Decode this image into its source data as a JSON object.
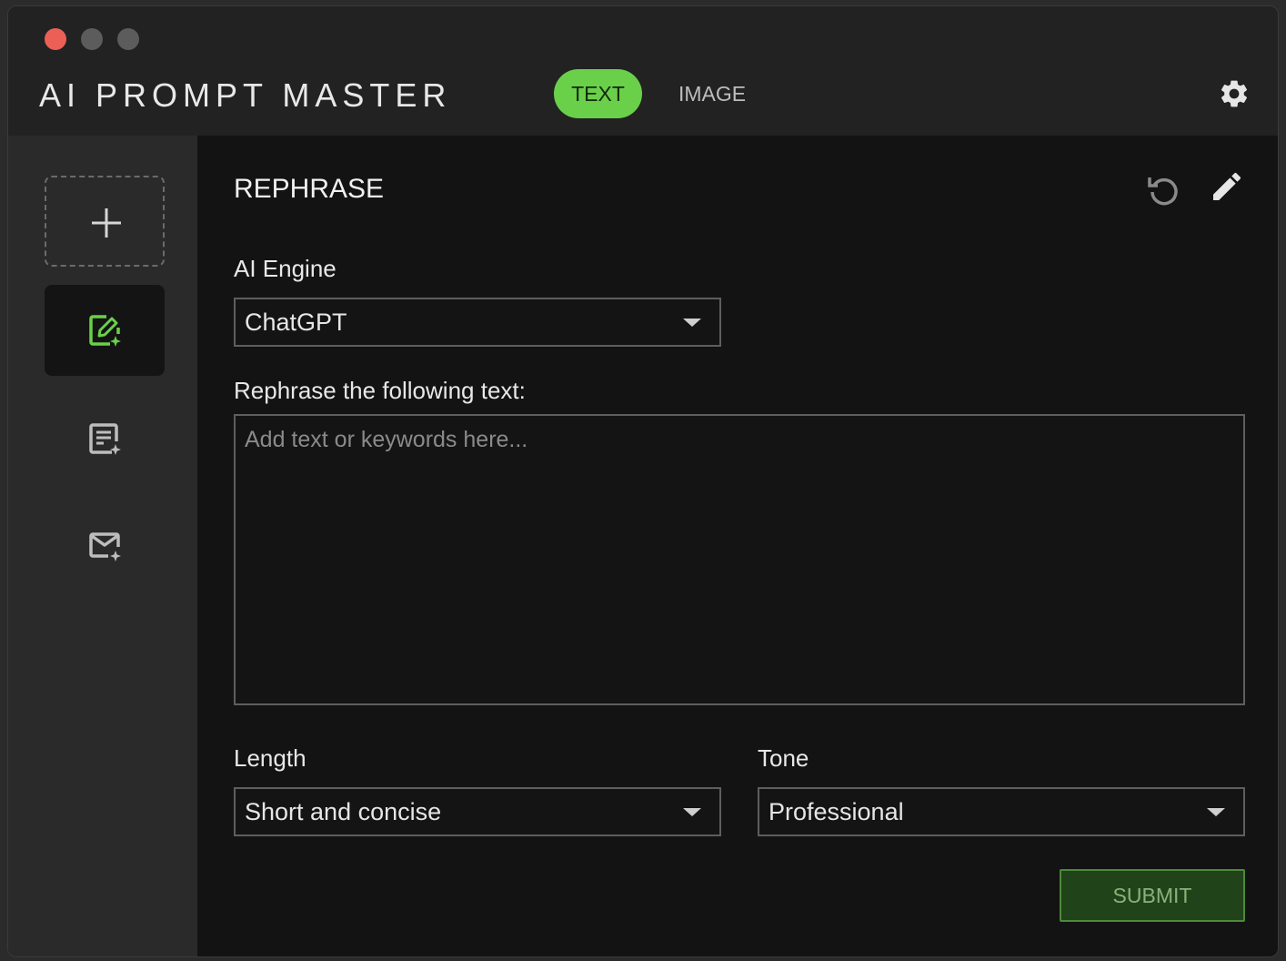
{
  "window": {
    "traffic_lights": [
      "close",
      "minimize",
      "maximize"
    ]
  },
  "header": {
    "app_title": "AI PROMPT MASTER",
    "tabs": [
      {
        "label": "TEXT",
        "active": true
      },
      {
        "label": "IMAGE",
        "active": false
      }
    ],
    "settings_icon": "gear-icon"
  },
  "sidebar": {
    "add_icon": "plus-icon",
    "items": [
      {
        "icon": "edit-sparkle-icon",
        "active": true
      },
      {
        "icon": "document-sparkle-icon",
        "active": false
      },
      {
        "icon": "mail-sparkle-icon",
        "active": false
      }
    ]
  },
  "main": {
    "title": "REPHRASE",
    "reset_icon": "reset-icon",
    "edit_icon": "pencil-icon",
    "engine": {
      "label": "AI Engine",
      "value": "ChatGPT"
    },
    "prompt": {
      "label": "Rephrase the following text:",
      "placeholder": "Add text or keywords here...",
      "value": ""
    },
    "length": {
      "label": "Length",
      "value": "Short and concise"
    },
    "tone": {
      "label": "Tone",
      "value": "Professional"
    },
    "submit_label": "SUBMIT"
  },
  "colors": {
    "accent": "#6ad04a",
    "accent_dark": "#21431a",
    "background": "#131313",
    "sidebar": "#2a2a2a",
    "titlebar": "#222222"
  }
}
